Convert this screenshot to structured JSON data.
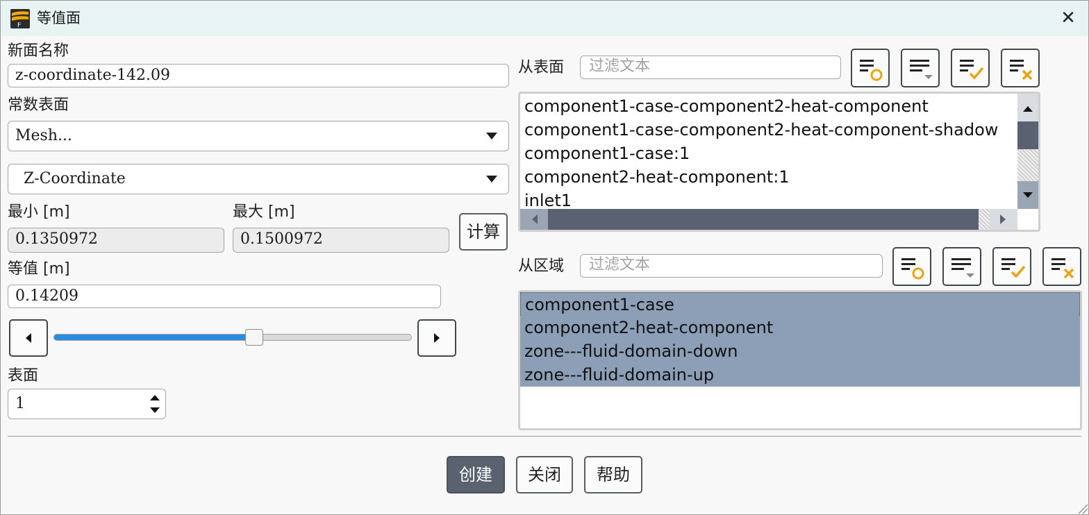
{
  "window": {
    "title": "等值面",
    "close_symbol": "✕"
  },
  "left": {
    "new_name_label": "新面名称",
    "new_name_value": "z-coordinate-142.09",
    "constant_surface_label": "常数表面",
    "category_value": "Mesh...",
    "quantity_value": "Z-Coordinate",
    "min_label": "最小 [m]",
    "min_value": "0.1350972",
    "max_label": "最大 [m]",
    "max_value": "0.1500972",
    "compute_label": "计算",
    "iso_value_label": "等值 [m]",
    "iso_value": "0.14209",
    "slider_level": 0.56,
    "surfaces_label": "表面",
    "surfaces_value": "1"
  },
  "from_surface": {
    "label": "从表面",
    "filter_placeholder": "过滤文本",
    "items": [
      "component1-case-component2-heat-component",
      "component1-case-component2-heat-component-shadow",
      "component1-case:1",
      "component2-heat-component:1",
      "inlet1"
    ]
  },
  "from_zone": {
    "label": "从区域",
    "filter_placeholder": "过滤文本",
    "items": [
      "component1-case",
      "component2-heat-component",
      "zone---fluid-domain-down",
      "zone---fluid-domain-up"
    ]
  },
  "toolbar_icons": [
    "select-none-icon",
    "select-filter-icon",
    "select-all-icon",
    "deselect-all-icon"
  ],
  "footer": {
    "create_label": "创建",
    "close_label": "关闭",
    "help_label": "帮助"
  },
  "colors": {
    "accent": "#2a8be0",
    "selection": "#8c9fb6",
    "primary_button": "#5a6270",
    "icon_orange": "#e8a317"
  }
}
